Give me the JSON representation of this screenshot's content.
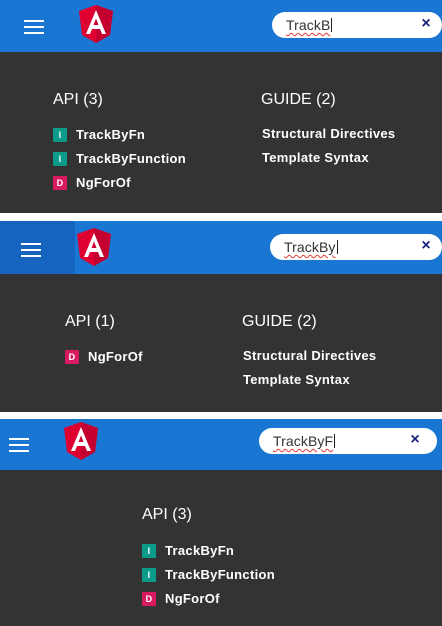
{
  "panels": [
    {
      "search": {
        "value": "TrackB",
        "clear": "×"
      },
      "api": {
        "heading": "API (3)",
        "items": [
          {
            "badge": "I",
            "label": "TrackByFn"
          },
          {
            "badge": "I",
            "label": "TrackByFunction"
          },
          {
            "badge": "D",
            "label": "NgForOf"
          }
        ]
      },
      "guide": {
        "heading": "GUIDE (2)",
        "items": [
          "Structural Directives",
          "Template Syntax"
        ]
      }
    },
    {
      "search": {
        "value": "TrackBy",
        "clear": "×"
      },
      "api": {
        "heading": "API (1)",
        "items": [
          {
            "badge": "D",
            "label": "NgForOf"
          }
        ]
      },
      "guide": {
        "heading": "GUIDE (2)",
        "items": [
          "Structural Directives",
          "Template Syntax"
        ]
      }
    },
    {
      "search": {
        "value": "TrackByF",
        "clear": "×"
      },
      "api": {
        "heading": "API (3)",
        "items": [
          {
            "badge": "I",
            "label": "TrackByFn"
          },
          {
            "badge": "I",
            "label": "TrackByFunction"
          },
          {
            "badge": "D",
            "label": "NgForOf"
          }
        ]
      }
    }
  ],
  "colors": {
    "toolbar": "#1976d2",
    "results_bg": "#333333",
    "badge_interface": "#0a9b8b",
    "badge_directive": "#d81b60"
  },
  "icons": {
    "menu": "hamburger-icon",
    "logo": "angular-logo-icon",
    "clear": "close-icon"
  }
}
